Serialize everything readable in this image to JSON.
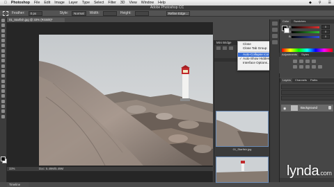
{
  "menubar": {
    "app_name": "Photoshop",
    "items": [
      "File",
      "Edit",
      "Image",
      "Layer",
      "Type",
      "Select",
      "Filter",
      "3D",
      "View",
      "Window",
      "Help"
    ]
  },
  "app_title": "Adobe Photoshop CC",
  "options_bar": {
    "feather_label": "Feather:",
    "feather_value": "0 px",
    "style_label": "Style:",
    "style_value": "Normal",
    "width_label": "Width:",
    "height_label": "Height:",
    "refine_label": "Refine Edge..."
  },
  "document": {
    "tab_title": "01_Starfish.jpg @ 33% (RGB/8)*",
    "zoom": "33%",
    "doc_info": "Doc: 5.49M/5.49M"
  },
  "mini_bridge": {
    "title": "Mini Bridge",
    "thumb_caption": "01_Starfish.jpg"
  },
  "context_menu": {
    "items": [
      {
        "label": "Close",
        "checked": false,
        "selected": false
      },
      {
        "label": "Close Tab Group",
        "checked": false,
        "selected": false
      },
      {
        "label": "Auto-Collapse Iconic Panels",
        "checked": false,
        "selected": true
      },
      {
        "label": "Auto-Show Hidden Panels",
        "checked": true,
        "selected": false
      },
      {
        "label": "Interface Options...",
        "checked": false,
        "selected": false
      }
    ]
  },
  "color_panel": {
    "tabs": [
      "Color",
      "Swatches"
    ],
    "channels": [
      {
        "label": "R",
        "value": "0",
        "color": "#e03030"
      },
      {
        "label": "G",
        "value": "0",
        "color": "#30c030"
      },
      {
        "label": "B",
        "value": "0",
        "color": "#3050e0"
      }
    ]
  },
  "adjustments_panel": {
    "tabs": [
      "Adjustments",
      "Styles"
    ]
  },
  "layers_panel": {
    "tabs": [
      "Layers",
      "Channels",
      "Paths"
    ],
    "layers": [
      {
        "name": "Background",
        "visible": true,
        "locked": true
      }
    ]
  },
  "bottom_tab": {
    "label": "Timeline"
  },
  "watermark": {
    "brand": "lynda",
    "suffix": ".com"
  },
  "colors": {
    "menu_highlight": "#3a6fd6",
    "panel_bg": "#454545",
    "canvas_bg": "#262626"
  }
}
